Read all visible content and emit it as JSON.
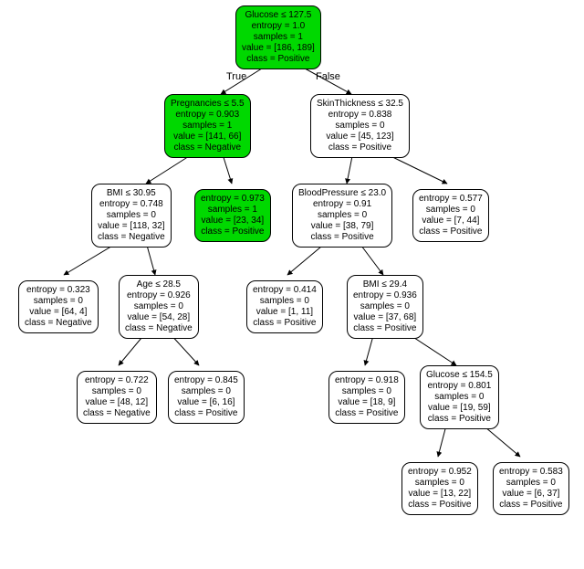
{
  "edge_labels": {
    "true": "True",
    "false": "False"
  },
  "nodes": {
    "root": {
      "hl": true,
      "lines": [
        "Glucose ≤ 127.5",
        "entropy = 1.0",
        "samples = 1",
        "value = [186, 189]",
        "class = Positive"
      ]
    },
    "n1": {
      "hl": true,
      "lines": [
        "Pregnancies ≤ 5.5",
        "entropy = 0.903",
        "samples = 1",
        "value = [141, 66]",
        "class = Negative"
      ]
    },
    "n2": {
      "hl": false,
      "lines": [
        "SkinThickness ≤ 32.5",
        "entropy = 0.838",
        "samples = 0",
        "value = [45, 123]",
        "class = Positive"
      ]
    },
    "n3": {
      "hl": false,
      "lines": [
        "BMI ≤ 30.95",
        "entropy = 0.748",
        "samples = 0",
        "value = [118, 32]",
        "class = Negative"
      ]
    },
    "n4": {
      "hl": true,
      "lines": [
        "entropy = 0.973",
        "samples = 1",
        "value = [23, 34]",
        "class = Positive"
      ]
    },
    "n5": {
      "hl": false,
      "lines": [
        "BloodPressure ≤ 23.0",
        "entropy = 0.91",
        "samples = 0",
        "value = [38, 79]",
        "class = Positive"
      ]
    },
    "n6": {
      "hl": false,
      "lines": [
        "entropy = 0.577",
        "samples = 0",
        "value = [7, 44]",
        "class = Positive"
      ]
    },
    "n7": {
      "hl": false,
      "lines": [
        "entropy = 0.323",
        "samples = 0",
        "value = [64, 4]",
        "class = Negative"
      ]
    },
    "n8": {
      "hl": false,
      "lines": [
        "Age ≤ 28.5",
        "entropy = 0.926",
        "samples = 0",
        "value = [54, 28]",
        "class = Negative"
      ]
    },
    "n9": {
      "hl": false,
      "lines": [
        "entropy = 0.414",
        "samples = 0",
        "value = [1, 11]",
        "class = Positive"
      ]
    },
    "n10": {
      "hl": false,
      "lines": [
        "BMI ≤ 29.4",
        "entropy = 0.936",
        "samples = 0",
        "value = [37, 68]",
        "class = Positive"
      ]
    },
    "n11": {
      "hl": false,
      "lines": [
        "entropy = 0.722",
        "samples = 0",
        "value = [48, 12]",
        "class = Negative"
      ]
    },
    "n12": {
      "hl": false,
      "lines": [
        "entropy = 0.845",
        "samples = 0",
        "value = [6, 16]",
        "class = Positive"
      ]
    },
    "n13": {
      "hl": false,
      "lines": [
        "entropy = 0.918",
        "samples = 0",
        "value = [18, 9]",
        "class = Positive"
      ]
    },
    "n14": {
      "hl": false,
      "lines": [
        "Glucose ≤ 154.5",
        "entropy = 0.801",
        "samples = 0",
        "value = [19, 59]",
        "class = Positive"
      ]
    },
    "n15": {
      "hl": false,
      "lines": [
        "entropy = 0.952",
        "samples = 0",
        "value = [13, 22]",
        "class = Positive"
      ]
    },
    "n16": {
      "hl": false,
      "lines": [
        "entropy = 0.583",
        "samples = 0",
        "value = [6, 37]",
        "class = Positive"
      ]
    }
  },
  "chart_data": {
    "type": "decision_tree",
    "highlighted_path": [
      "root",
      "n1",
      "n4"
    ],
    "edges": [
      {
        "from": "root",
        "to": "n1",
        "label": "True"
      },
      {
        "from": "root",
        "to": "n2",
        "label": "False"
      },
      {
        "from": "n1",
        "to": "n3"
      },
      {
        "from": "n1",
        "to": "n4"
      },
      {
        "from": "n2",
        "to": "n5"
      },
      {
        "from": "n2",
        "to": "n6"
      },
      {
        "from": "n3",
        "to": "n7"
      },
      {
        "from": "n3",
        "to": "n8"
      },
      {
        "from": "n5",
        "to": "n9"
      },
      {
        "from": "n5",
        "to": "n10"
      },
      {
        "from": "n8",
        "to": "n11"
      },
      {
        "from": "n8",
        "to": "n12"
      },
      {
        "from": "n10",
        "to": "n13"
      },
      {
        "from": "n10",
        "to": "n14"
      },
      {
        "from": "n14",
        "to": "n15"
      },
      {
        "from": "n14",
        "to": "n16"
      }
    ]
  }
}
